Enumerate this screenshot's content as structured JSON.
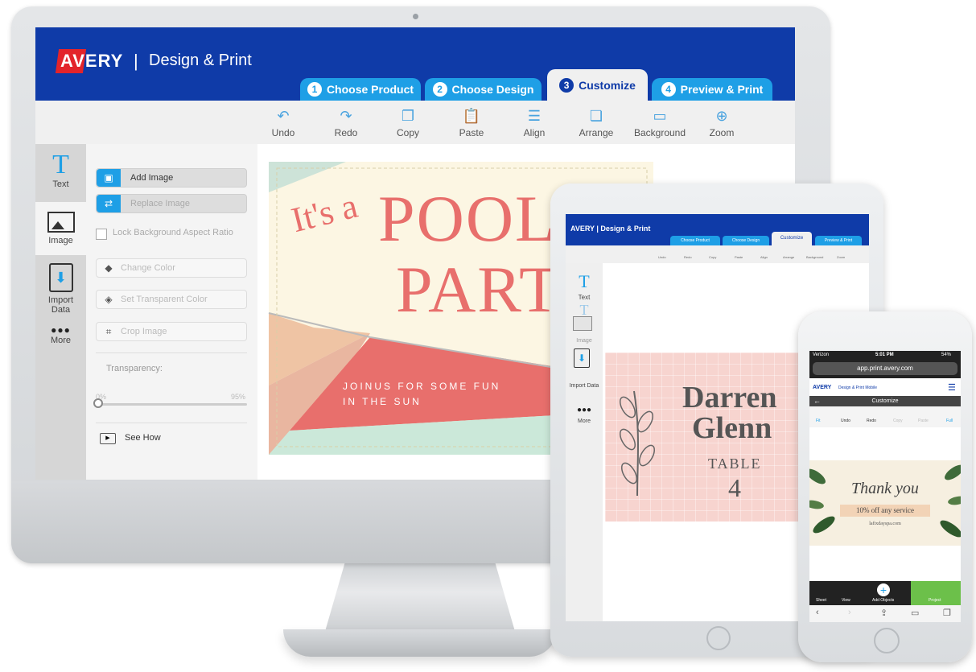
{
  "desktop": {
    "brand": {
      "logo": "AVERY",
      "separator": "|",
      "name": "Design & Print"
    },
    "tabs": [
      {
        "num": "1",
        "label": "Choose Product"
      },
      {
        "num": "2",
        "label": "Choose Design"
      },
      {
        "num": "3",
        "label": "Customize"
      },
      {
        "num": "4",
        "label": "Preview & Print"
      }
    ],
    "toolbar": [
      {
        "icon": "undo-icon",
        "glyph": "↶",
        "label": "Undo"
      },
      {
        "icon": "redo-icon",
        "glyph": "↷",
        "label": "Redo"
      },
      {
        "icon": "copy-icon",
        "glyph": "❐",
        "label": "Copy"
      },
      {
        "icon": "paste-icon",
        "glyph": "📋",
        "label": "Paste"
      },
      {
        "icon": "align-icon",
        "glyph": "☰",
        "label": "Align"
      },
      {
        "icon": "arrange-icon",
        "glyph": "❏",
        "label": "Arrange"
      },
      {
        "icon": "background-icon",
        "glyph": "▭",
        "label": "Background"
      },
      {
        "icon": "zoom-icon",
        "glyph": "⊕",
        "label": "Zoom"
      }
    ],
    "side": [
      {
        "glyph": "T",
        "label": "Text"
      },
      {
        "glyph": "▲",
        "label": "Image"
      },
      {
        "glyph": "⬇",
        "label": "Import Data"
      },
      {
        "glyph": "●●●",
        "label": "More"
      }
    ],
    "options": {
      "add_image": "Add Image",
      "replace_image": "Replace Image",
      "lock_ratio": "Lock Background Aspect Ratio",
      "change_color": "Change Color",
      "set_transparent": "Set Transparent Color",
      "crop_image": "Crop Image",
      "transparency": "Transparency:",
      "min": "0%",
      "max": "95%",
      "see_how": "See How"
    },
    "card": {
      "line1": "It's a",
      "line2": "POOL",
      "line3": "PART",
      "sub1": "JOINUS FOR SOME FUN",
      "sub2": "IN THE SUN"
    },
    "colors": {
      "header": "#0f3ba8",
      "tab": "#1e9fe6",
      "accent": "#e86f6c"
    }
  },
  "tablet": {
    "brand": "AVERY | Design & Print",
    "tabs": [
      "Choose Product",
      "Choose Design",
      "Customize",
      "Preview & Print"
    ],
    "toolbar": [
      "Undo",
      "Redo",
      "Copy",
      "Paste",
      "Align",
      "Arrange",
      "Background",
      "Zoom"
    ],
    "side": [
      "Text",
      "Text",
      "Image",
      "Import Data",
      "More"
    ],
    "card": {
      "name1": "Darren",
      "name2": "Glenn",
      "table": "TABLE",
      "num": "4"
    }
  },
  "phone": {
    "status": {
      "carrier": "Verizon",
      "time": "5:01 PM",
      "battery": "54%"
    },
    "url": "app.print.avery.com",
    "brand": "AVERY",
    "brand_sub": "Design & Print Mobile",
    "title": "Customize",
    "tools": [
      "Fit",
      "Undo",
      "Redo",
      "Copy",
      "Paste",
      "Full"
    ],
    "card": {
      "line1": "Thank you",
      "line2": "10% off any service",
      "line3": "lafixdayspa.com"
    },
    "bottom": [
      "Sheet",
      "View",
      "Add Objects",
      "Project"
    ]
  }
}
